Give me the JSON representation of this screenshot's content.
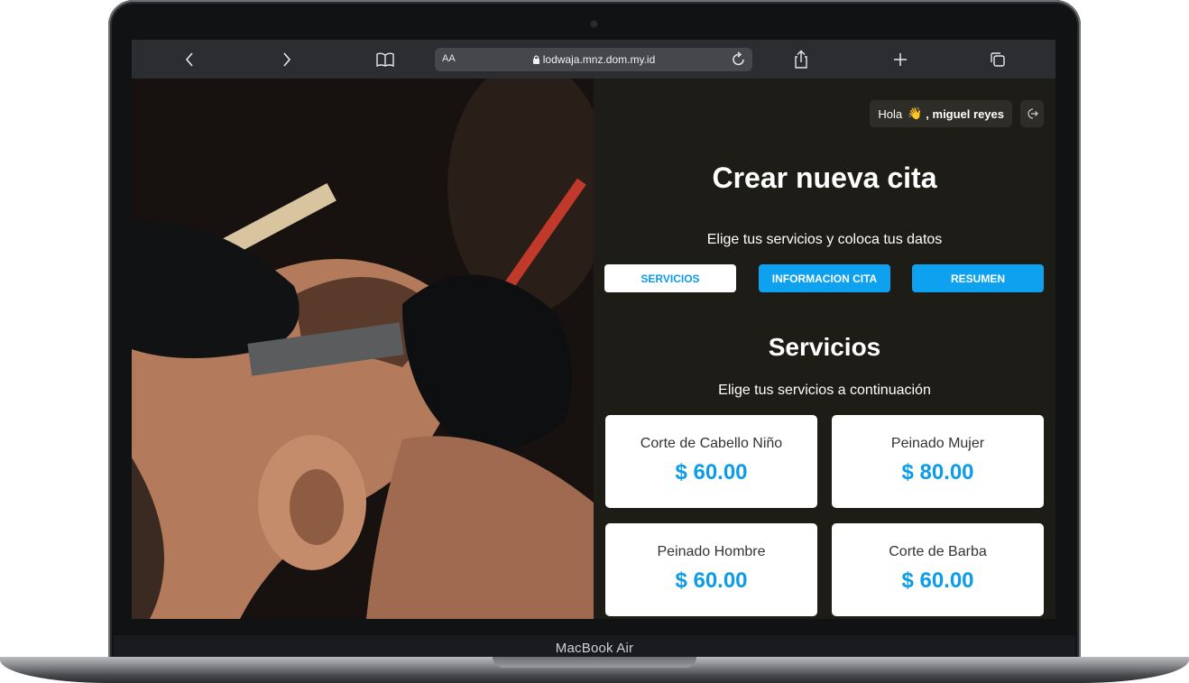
{
  "device": {
    "label": "MacBook Air"
  },
  "browser": {
    "text_size_label": "AA",
    "url": "lodwaja.mnz.dom.my.id",
    "icons": [
      "chevron-left-icon",
      "chevron-right-icon",
      "book-icon",
      "lock-icon",
      "reload-icon",
      "share-icon",
      "plus-icon",
      "tabs-icon"
    ]
  },
  "header": {
    "greeting": "Hola",
    "greeting_emoji": "👋",
    "user": ", miguel reyes"
  },
  "page": {
    "title": "Crear nueva cita",
    "subtitle": "Elige tus servicios y coloca tus datos"
  },
  "tabs": [
    {
      "label": "SERVICIOS"
    },
    {
      "label": "INFORMACION CITA"
    },
    {
      "label": "RESUMEN"
    }
  ],
  "services_section": {
    "title": "Servicios",
    "subtitle": "Elige tus servicios a continuación",
    "items": [
      {
        "name": "Corte de Cabello Niño",
        "price": "$ 60.00"
      },
      {
        "name": "Peinado Mujer",
        "price": "$ 80.00"
      },
      {
        "name": "Peinado Hombre",
        "price": "$ 60.00"
      },
      {
        "name": "Corte de Barba",
        "price": "$ 60.00"
      }
    ]
  },
  "colors": {
    "accent": "#0da1f0",
    "app_background": "#1d1c17",
    "toolbar": "#2b2d31"
  }
}
